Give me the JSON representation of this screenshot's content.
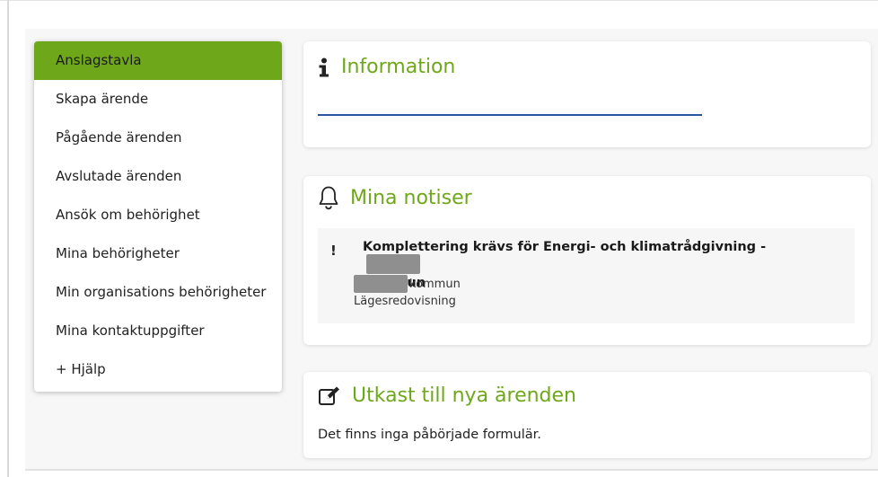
{
  "sidebar": {
    "items": [
      {
        "label": "Anslagstavla",
        "active": true
      },
      {
        "label": "Skapa ärende"
      },
      {
        "label": "Pågående ärenden"
      },
      {
        "label": "Avslutade ärenden"
      },
      {
        "label": "Ansök om behörighet"
      },
      {
        "label": "Mina behörigheter"
      },
      {
        "label": "Min organisations behörigheter"
      },
      {
        "label": "Mina kontaktuppgifter"
      },
      {
        "label": "+ Hjälp"
      }
    ],
    "active_color": "#6ea81a"
  },
  "information": {
    "title": "Information",
    "icon": "info-icon"
  },
  "notifications": {
    "title": "Mina notiser",
    "icon": "bell-icon",
    "items": [
      {
        "marker": "!",
        "title_prefix": "Komplettering krävs för Energi- och klimatrådgivning -",
        "title_suffix": "kommun",
        "org_suffix": "kommun",
        "type": "Lägesredovisning"
      }
    ]
  },
  "drafts": {
    "title": "Utkast till nya ärenden",
    "icon": "edit-icon",
    "empty_text": "Det finns inga påbörjade formulär."
  },
  "colors": {
    "accent": "#6ea81a",
    "underline": "#2d55a3"
  }
}
